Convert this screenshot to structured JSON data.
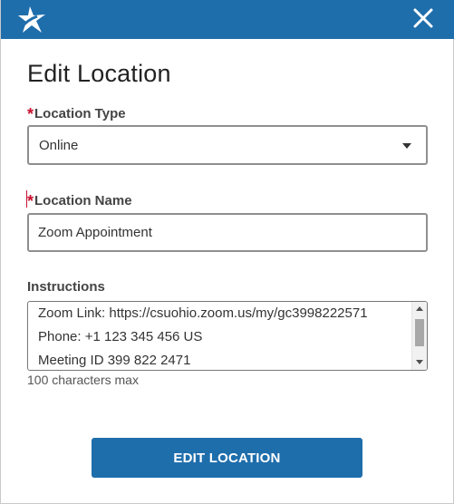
{
  "header": {
    "logo_icon": "star-logo-icon",
    "close_icon": "close-x-icon",
    "bar_color": "#1f6eac"
  },
  "dialog": {
    "title": "Edit Location"
  },
  "form": {
    "location_type": {
      "required_mark": "*",
      "label": "Location Type",
      "selected": "Online"
    },
    "location_name": {
      "required_mark": "*",
      "label": "Location Name",
      "value": "Zoom Appointment"
    },
    "instructions": {
      "label": "Instructions",
      "lines": [
        "Zoom Link: https://csuohio.zoom.us/my/gc3998222571",
        "Phone: +1 123 345 456 US",
        "Meeting ID 399 822 2471"
      ],
      "hint": "100 characters max"
    }
  },
  "actions": {
    "submit_label": "EDIT LOCATION",
    "accent": "#1f6eac",
    "required_color": "#c8102e"
  }
}
